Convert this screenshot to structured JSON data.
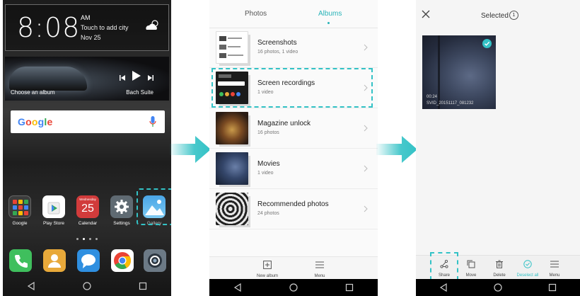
{
  "home": {
    "clock": {
      "time": "8:08",
      "ampm": "AM",
      "city_prompt": "Touch to add city",
      "date": "Nov 25"
    },
    "music": {
      "album": "Choose an album",
      "artist": "Bach Suite"
    },
    "search": {
      "logo": "Google"
    },
    "apps": [
      {
        "label": "Google"
      },
      {
        "label": "Play Store"
      },
      {
        "label": "Calendar",
        "weekday": "Wednesday",
        "day": "25"
      },
      {
        "label": "Settings"
      },
      {
        "label": "Gallery"
      }
    ],
    "dock": [
      "phone-icon",
      "contacts-icon",
      "messages-icon",
      "chrome-icon",
      "camera-icon"
    ]
  },
  "albums": {
    "tabs": {
      "photos": "Photos",
      "albums": "Albums"
    },
    "list": [
      {
        "name": "Screenshots",
        "count": "16 photos, 1 video"
      },
      {
        "name": "Screen recordings",
        "count": "1 video"
      },
      {
        "name": "Magazine unlock",
        "count": "16 photos"
      },
      {
        "name": "Movies",
        "count": "1 video"
      },
      {
        "name": "Recommended photos",
        "count": "24 photos"
      }
    ],
    "bottom": {
      "new_album": "New album",
      "menu": "Menu"
    }
  },
  "selected": {
    "title": "Selected",
    "count": "1",
    "video": {
      "duration": "00:24",
      "filename": "SVID_20151117_081232"
    },
    "actions": {
      "share": "Share",
      "move": "Move",
      "delete": "Delete",
      "deselect_all": "Deselect all",
      "menu": "Menu"
    }
  },
  "colors": {
    "accent": "#33c2c6"
  }
}
